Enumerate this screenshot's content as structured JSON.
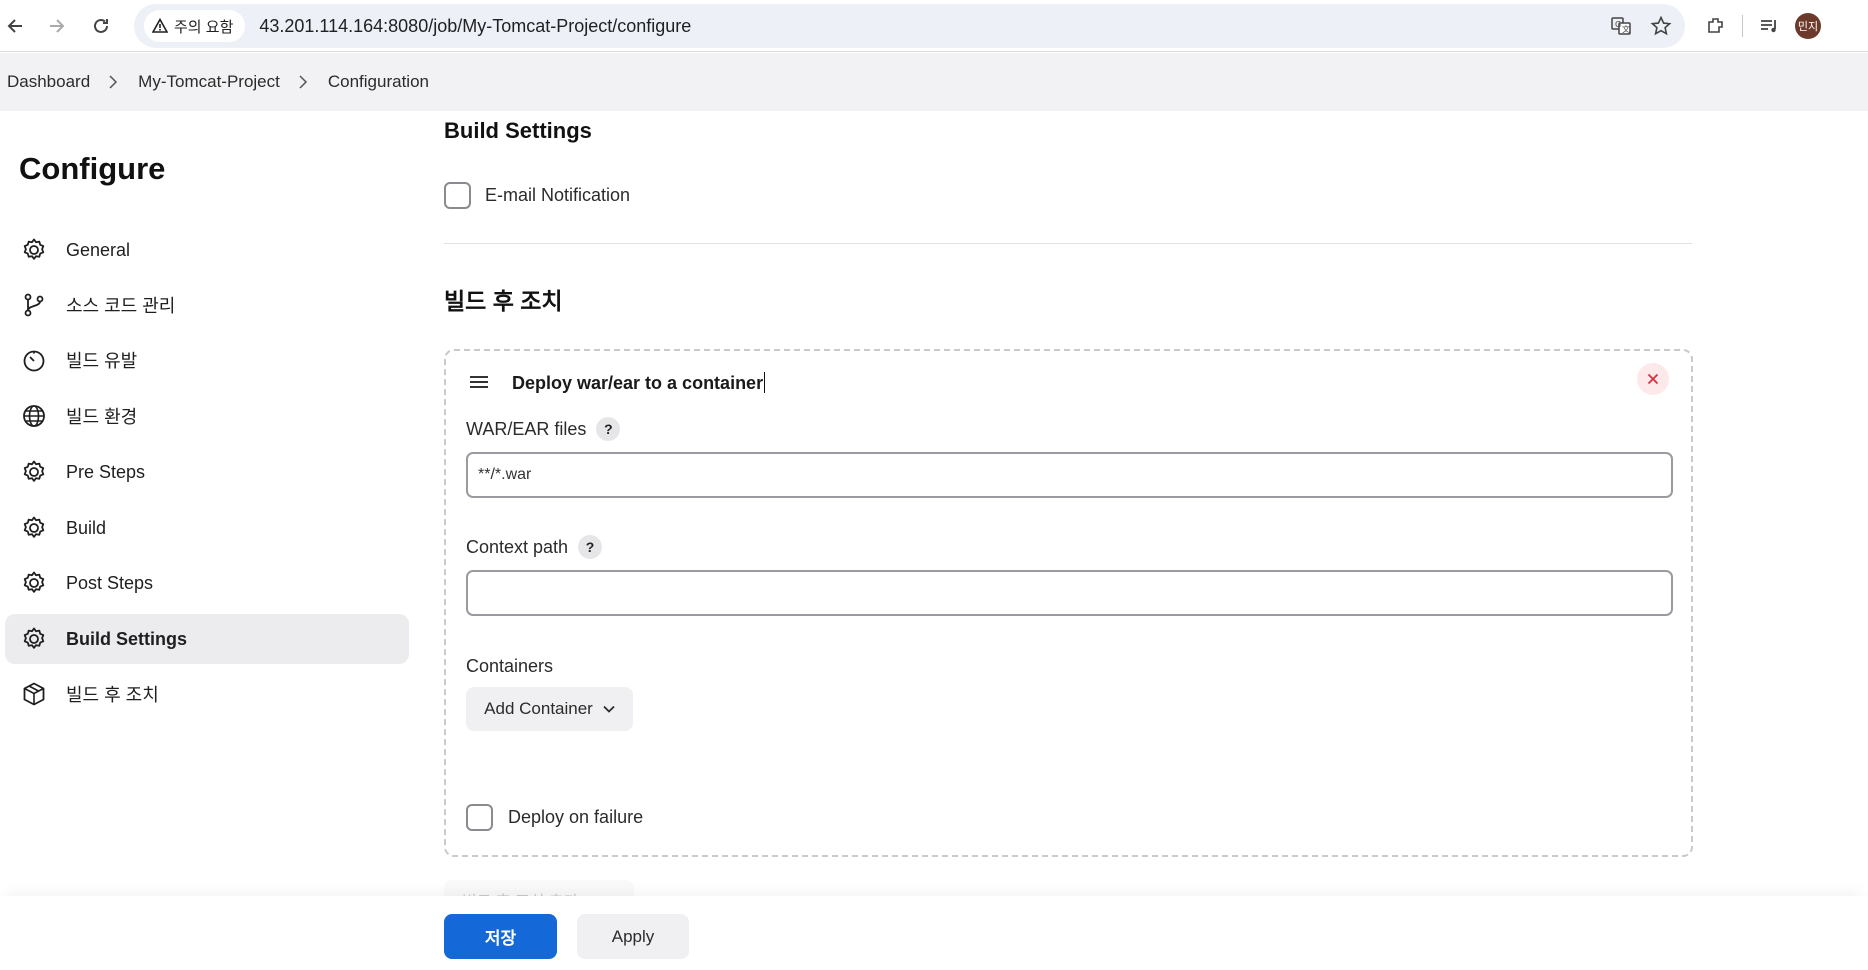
{
  "browser": {
    "security_label": "주의 요함",
    "url": "43.201.114.164:8080/job/My-Tomcat-Project/configure",
    "profile_initials": "민지"
  },
  "breadcrumb": [
    "Dashboard",
    "My-Tomcat-Project",
    "Configuration"
  ],
  "sidebar": {
    "title": "Configure",
    "items": [
      {
        "label": "General",
        "icon": "gear-icon"
      },
      {
        "label": "소스 코드 관리",
        "icon": "branch-icon"
      },
      {
        "label": "빌드 유발",
        "icon": "timer-icon"
      },
      {
        "label": "빌드 환경",
        "icon": "globe-icon"
      },
      {
        "label": "Pre Steps",
        "icon": "gear-icon"
      },
      {
        "label": "Build",
        "icon": "gear-icon"
      },
      {
        "label": "Post Steps",
        "icon": "gear-icon"
      },
      {
        "label": "Build Settings",
        "icon": "gear-icon",
        "active": true
      },
      {
        "label": "빌드 후 조치",
        "icon": "package-icon"
      }
    ]
  },
  "build_settings": {
    "heading": "Build Settings",
    "email_notification_label": "E-mail Notification",
    "email_notification_checked": false
  },
  "post_build": {
    "heading": "빌드 후 조치",
    "step": {
      "title": "Deploy war/ear to a container",
      "war_ear_label": "WAR/EAR files",
      "war_ear_value": "**/*.war",
      "context_path_label": "Context path",
      "context_path_value": "",
      "containers_label": "Containers",
      "add_container_label": "Add Container",
      "deploy_on_failure_label": "Deploy on failure",
      "deploy_on_failure_checked": false
    },
    "add_step_label": "빌드 후 조치 추가"
  },
  "footer": {
    "save_label": "저장",
    "apply_label": "Apply"
  },
  "colors": {
    "primary": "#1468d8",
    "active_sidebar_bg": "#ececef",
    "remove_bg": "#fde8ea",
    "remove_fg": "#d9303e"
  }
}
